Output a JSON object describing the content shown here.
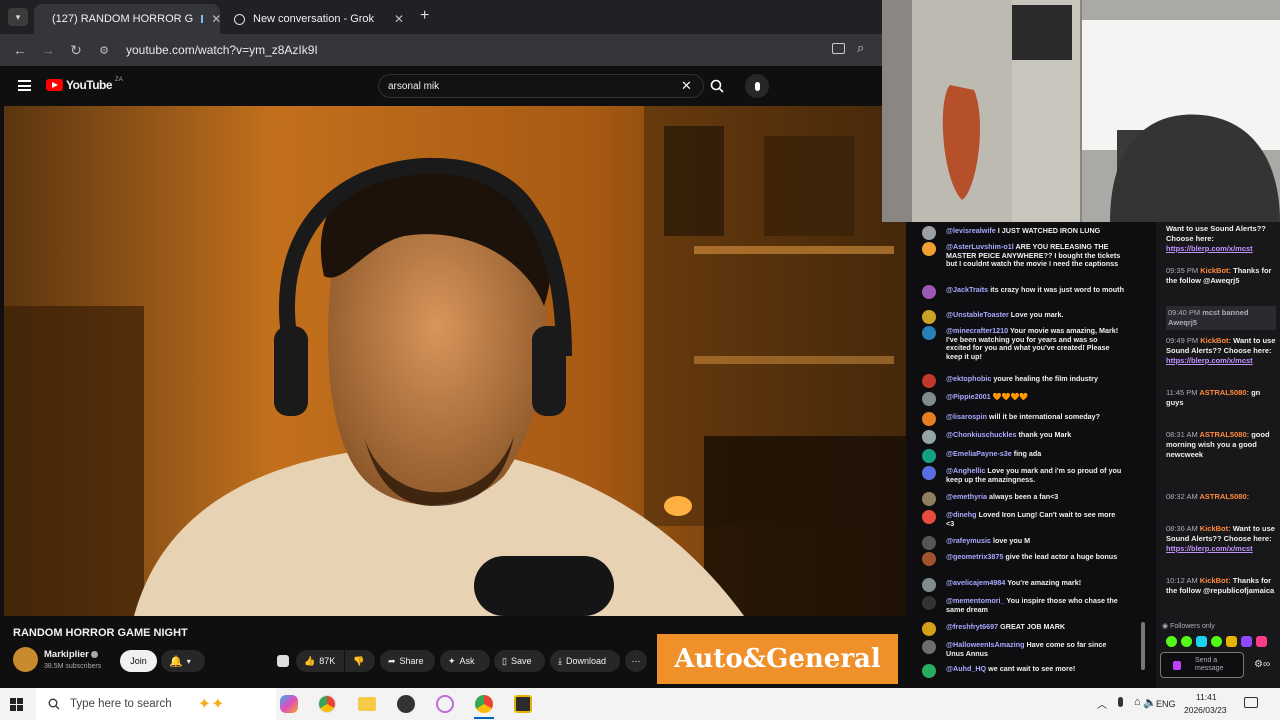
{
  "browser": {
    "tabs": [
      {
        "label": "(127) RANDOM HORROR G",
        "active": true
      },
      {
        "label": "New conversation - Grok",
        "active": false
      }
    ],
    "url": "youtube.com/watch?v=ym_z8AzIk9I"
  },
  "youtube": {
    "logo_text": "YouTube",
    "region": "ZA",
    "search_value": "arsonal mik",
    "video_title": "RANDOM HORROR GAME NIGHT",
    "channel_name": "Markiplier",
    "subscribers": "38.5M subscribers",
    "join_label": "Join",
    "like_count": "87K",
    "share_label": "Share",
    "ask_label": "Ask",
    "save_label": "Save",
    "download_label": "Download",
    "ad_text": "Auto&General"
  },
  "chat": {
    "messages": [
      {
        "user": "@levisrealwife",
        "text": "I JUST WATCHED IRON LUNG",
        "color": "#9aa0a6"
      },
      {
        "user": "@AsterLuvshim-o1l",
        "text": "ARE YOU RELEASING THE MASTER PEICE ANYWHERE?? I bought the tickets but I couldnt watch the movie I need the captionss",
        "color": "#f0a030"
      },
      {
        "user": "@JackTraits",
        "text": "its crazy how it was just word to mouth",
        "color": "#9b59b6"
      },
      {
        "user": "@UnstableToaster",
        "text": "Love you mark.",
        "color": "#c9a227"
      },
      {
        "user": "@minecrafter1210",
        "text": "Your movie was amazing, Mark! I've been watching you for years and was so excited for you and what you've created! Please keep it up!",
        "color": "#2980b9"
      },
      {
        "user": "@ektophobic",
        "text": "youre healing the film industry",
        "color": "#c0392b"
      },
      {
        "user": "@Pippie2001",
        "text": "🧡🧡🧡🧡",
        "color": "#7f8c8d"
      },
      {
        "user": "@lisarospin",
        "text": "will it be international someday?",
        "color": "#e67e22"
      },
      {
        "user": "@Chonkiuschuckles",
        "text": "thank you Mark",
        "color": "#95a5a6"
      },
      {
        "user": "@EmeliaPayne-s3e",
        "text": "fing ada",
        "color": "#16a085"
      },
      {
        "user": "@Anghellic",
        "text": "Love you mark and i'm so proud of you keep up the amazingness.",
        "color": "#5b6ee1"
      },
      {
        "user": "@emethyria",
        "text": "always been a fan<3",
        "color": "#8e7f5f"
      },
      {
        "user": "@dinehg",
        "text": "Loved Iron Lung! Can't wait to see more <3",
        "color": "#e74c3c"
      },
      {
        "user": "@rafeymusic",
        "text": "love you M",
        "color": "#555555"
      },
      {
        "user": "@geometrix3875",
        "text": "give the lead actor a huge bonus",
        "color": "#a0522d"
      },
      {
        "user": "@avelicajem4984",
        "text": "You're amazing mark!",
        "color": "#7f8c8d"
      },
      {
        "user": "@mementomori_",
        "text": "You inspire those who chase the same dream",
        "color": "#333333"
      },
      {
        "user": "@freshfryt6697",
        "text": "GREAT JOB MARK",
        "color": "#d4a017"
      },
      {
        "user": "@HalloweenIsAmazing",
        "text": "Have come so far since Unus Annus",
        "color": "#6d6d6d"
      },
      {
        "user": "@Auhd_HQ",
        "text": "we cant wait to see more!",
        "color": "#27ae60"
      }
    ]
  },
  "side_chat": {
    "items": [
      {
        "time": "",
        "user": "",
        "text": "Want to use Sound Alerts?? Choose here:",
        "link": "https://blerp.com/x/mcst"
      },
      {
        "time": "09:35 PM",
        "user": "KickBot:",
        "text": "Thanks for the follow @Aweqrj5",
        "link": ""
      },
      {
        "time": "09:40 PM",
        "user": "",
        "text": "mcst banned Aweqrj5",
        "link": ""
      },
      {
        "time": "09:49 PM",
        "user": "KickBot:",
        "text": "Want to use Sound Alerts?? Choose here:",
        "link": "https://blerp.com/x/mcst"
      },
      {
        "time": "11:45 PM",
        "user": "ASTRAL5080:",
        "text": "gn guys",
        "link": ""
      },
      {
        "time": "08:31 AM",
        "user": "ASTRAL5080:",
        "text": "good morning wish you a good newcweek",
        "link": ""
      },
      {
        "time": "08:32 AM",
        "user": "ASTRAL5080:",
        "text": "",
        "link": ""
      },
      {
        "time": "08:36 AM",
        "user": "KickBot:",
        "text": "Want to use Sound Alerts?? Choose here:",
        "link": "https://blerp.com/x/mcst"
      },
      {
        "time": "10:12 AM",
        "user": "KickBot:",
        "text": "Thanks for the follow @republicofjamaica",
        "link": ""
      }
    ],
    "followers_only": "Followers only",
    "send_placeholder": "Send a message"
  },
  "taskbar": {
    "search_placeholder": "Type here to search",
    "language": "ENG",
    "time": "11:41",
    "date": "2026/03/23"
  }
}
